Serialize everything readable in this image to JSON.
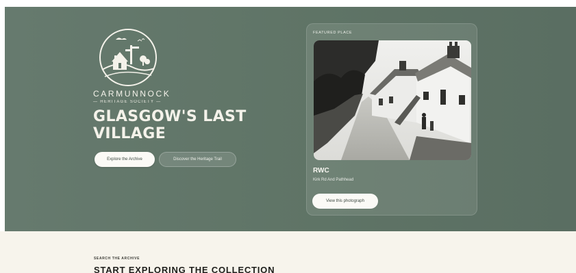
{
  "hero": {
    "brand": {
      "name": "CARMUNNOCK",
      "subtitle": "— HERITAGE SOCIETY —"
    },
    "headline": "GLASGOW'S LAST VILLAGE",
    "buttons": {
      "explore_label": "Explore the Archive",
      "trail_label": "Discover the Heritage Trail"
    }
  },
  "featured": {
    "label": "FEATURED PLACE",
    "title": "RWC",
    "place": "Kirk Rd And Pathhead",
    "button_label": "View this photograph"
  },
  "search": {
    "eyebrow": "SEARCH THE ARCHIVE",
    "heading": "START EXPLORING THE COLLECTION"
  },
  "colors": {
    "hero_bg": "#627569",
    "cream": "#f7f4ec",
    "text_light": "#f4f2ea",
    "dark_text": "#1f1f1c"
  },
  "icons": {
    "logo": "village-logo-icon"
  }
}
